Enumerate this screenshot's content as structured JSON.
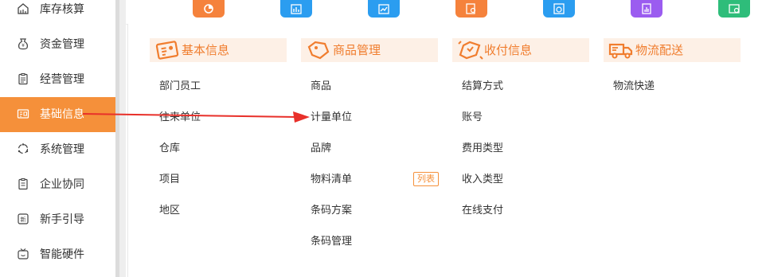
{
  "sidebar": {
    "items": [
      {
        "label": "库存核算",
        "icon": "inventory-accounting-icon"
      },
      {
        "label": "资金管理",
        "icon": "money-bag-icon"
      },
      {
        "label": "经营管理",
        "icon": "clipboard-icon"
      },
      {
        "label": "基础信息",
        "icon": "id-card-icon",
        "active": true
      },
      {
        "label": "系统管理",
        "icon": "cycle-icon"
      },
      {
        "label": "企业协同",
        "icon": "clipboard-list-icon"
      },
      {
        "label": "新手引导",
        "icon": "new-badge-icon"
      },
      {
        "label": "智能硬件",
        "icon": "tv-device-icon"
      }
    ]
  },
  "top_tiles": [
    {
      "icon": "pie-chart-icon",
      "color": "#f5823c"
    },
    {
      "icon": "bar-chart-icon",
      "color": "#2b9df0"
    },
    {
      "icon": "trend-chart-icon",
      "color": "#2b9df0"
    },
    {
      "icon": "search-report-icon",
      "color": "#f5823c"
    },
    {
      "icon": "money-report-icon",
      "color": "#2b9df0"
    },
    {
      "icon": "stats-report-icon",
      "color": "#9b5cf0"
    },
    {
      "icon": "cash-report-icon",
      "color": "#2ebd7a"
    }
  ],
  "menu": {
    "basic_info": {
      "title": "基本信息",
      "items": [
        "部门员工",
        "往来单位",
        "仓库",
        "项目",
        "地区"
      ]
    },
    "goods": {
      "title": "商品管理",
      "items": [
        "商品",
        "计量单位",
        "品牌",
        "物料清单",
        "条码方案",
        "条码管理"
      ],
      "tag": "列表"
    },
    "payment": {
      "title": "收付信息",
      "items": [
        "结算方式",
        "账号",
        "费用类型",
        "收入类型",
        "在线支付"
      ]
    },
    "logistics": {
      "title": "物流配送",
      "items": [
        "物流快递"
      ]
    }
  },
  "colors": {
    "accent": "#f5903a",
    "header_bg": "#fdf0e6",
    "arrow": "#e8302a"
  }
}
